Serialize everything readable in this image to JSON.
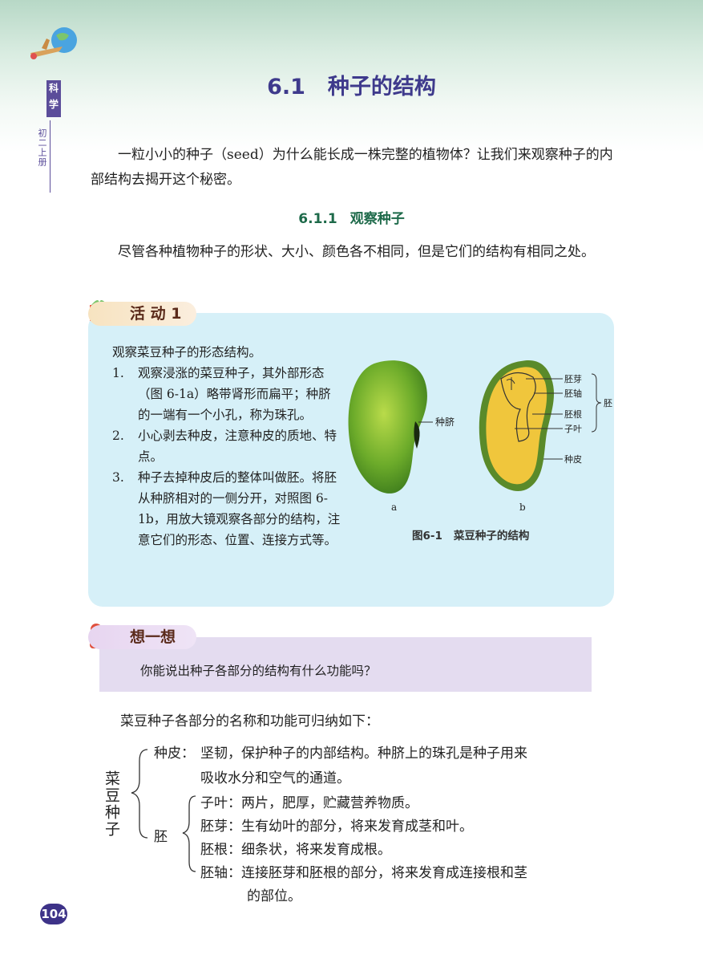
{
  "header": {
    "side_tab": "科学",
    "side_label": "初二上册",
    "title_num": "6.1",
    "title_text": "种子的结构"
  },
  "intro": "一粒小小的种子（seed）为什么能长成一株完整的植物体？让我们来观察种子的内部结构去揭开这个秘密。",
  "section": {
    "num": "6.1.1",
    "text": "观察种子"
  },
  "para2": "尽管各种植物种子的形状、大小、颜色各不相同，但是它们的结构有相同之处。",
  "activity": {
    "tag": "活 动 1",
    "lead": "观察菜豆种子的形态结构。",
    "items": [
      {
        "n": "1.",
        "text": "观察浸涨的菜豆种子，其外部形态（图 6-1a）略带肾形而扁平；种脐的一端有一个小孔，称为珠孔。"
      },
      {
        "n": "2.",
        "text": "小心剥去种皮，注意种皮的质地、特点。"
      },
      {
        "n": "3.",
        "text": "种子去掉种皮后的整体叫做胚。将胚从种脐相对的一侧分开，对照图 6-1b，用放大镜观察各部分的结构，注意它们的形态、位置、连接方式等。"
      }
    ]
  },
  "figure": {
    "label_hilum": "种脐",
    "label_plumule": "胚芽",
    "label_hypocotyl": "胚轴",
    "label_radicle": "胚根",
    "label_cotyledon": "子叶",
    "label_seedcoat": "种皮",
    "label_embryo": "胚",
    "sub_a": "a",
    "sub_b": "b",
    "caption_num": "图6-1",
    "caption_text": "菜豆种子的结构"
  },
  "think": {
    "tag": "想一想",
    "question": "你能说出种子各部分的结构有什么功能吗？"
  },
  "summary": {
    "intro": "菜豆种子各部分的名称和功能可归纳如下：",
    "seed": "菜豆种子",
    "coat_term": "种皮：",
    "coat_line1": "坚韧，保护种子的内部结构。种脐上的珠孔是种子用来",
    "coat_line2": "吸收水分和空气的通道。",
    "embryo": "胚",
    "parts": [
      {
        "term": "子叶：",
        "desc": "两片，肥厚，贮藏营养物质。"
      },
      {
        "term": "胚芽：",
        "desc": "生有幼叶的部分，将来发育成茎和叶。"
      },
      {
        "term": "胚根：",
        "desc": "细条状，将来发育成根。"
      },
      {
        "term": "胚轴：",
        "desc": "连接胚芽和胚根的部分，将来发育成连接根和茎"
      }
    ],
    "axis_line2": "的部位。"
  },
  "page_number": "104",
  "colors": {
    "title": "#3e3a8c",
    "section": "#1e6a4a",
    "activity_bg": "#d6f0f8",
    "think_bg": "#e4dcf0",
    "seed_green": "#6cab2a",
    "embryo_yellow": "#f0c63c"
  }
}
